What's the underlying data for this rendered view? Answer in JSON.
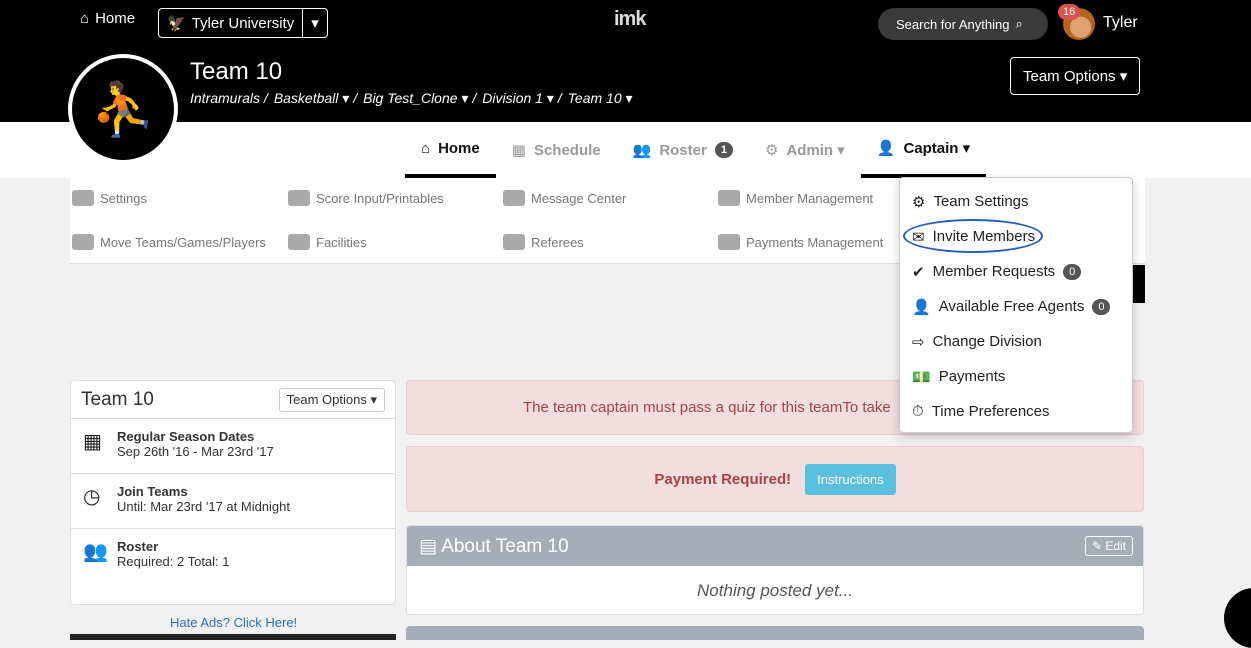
{
  "topbar": {
    "home_label": "Home",
    "university": "Tyler University",
    "logo_text": "imk",
    "search_label": "Search for Anything",
    "notifications": "16",
    "user": "Tyler"
  },
  "team": {
    "title": "Team 10",
    "crumbs": [
      "Intramurals /",
      "Basketball ▾ /",
      "Big Test_Clone ▾ /",
      "Division 1 ▾ /",
      "Team 10 ▾"
    ],
    "options_label": "Team Options ▾"
  },
  "tabs": [
    {
      "label": "Home"
    },
    {
      "label": "Schedule"
    },
    {
      "label": "Roster",
      "badge": "1"
    },
    {
      "label": "Admin ▾"
    },
    {
      "label": "Captain ▾"
    }
  ],
  "subnav": {
    "settings": "Settings",
    "score": "Score Input/Printables",
    "message": "Message Center",
    "member": "Member Management",
    "move": "Move Teams/Games/Players",
    "facilities": "Facilities",
    "referees": "Referees",
    "payments": "Payments Management"
  },
  "dropdown": {
    "team_settings": "Team Settings",
    "invite": "Invite Members",
    "requests": "Member Requests",
    "requests_count": "0",
    "free_agents": "Available Free Agents",
    "free_agents_count": "0",
    "change_div": "Change Division",
    "payments": "Payments",
    "time_prefs": "Time Preferences"
  },
  "left_card": {
    "title": "Team 10",
    "options": "Team Options ▾",
    "season_title": "Regular Season Dates",
    "season_dates": "Sep 26th '16 - Mar 23rd '17",
    "join_title": "Join Teams",
    "join_until": "Until: Mar 23rd '17 at Midnight",
    "roster_title": "Roster",
    "roster_info": "Required: 2   Total: 1"
  },
  "hate_ads": "Hate Ads? Click Here!",
  "alerts": {
    "quiz": "The team captain must pass a quiz for this teamTo take",
    "payment": "Payment Required!",
    "instructions": "Instructions"
  },
  "about": {
    "title": "About Team 10",
    "edit": "Edit",
    "body": "Nothing posted yet..."
  }
}
